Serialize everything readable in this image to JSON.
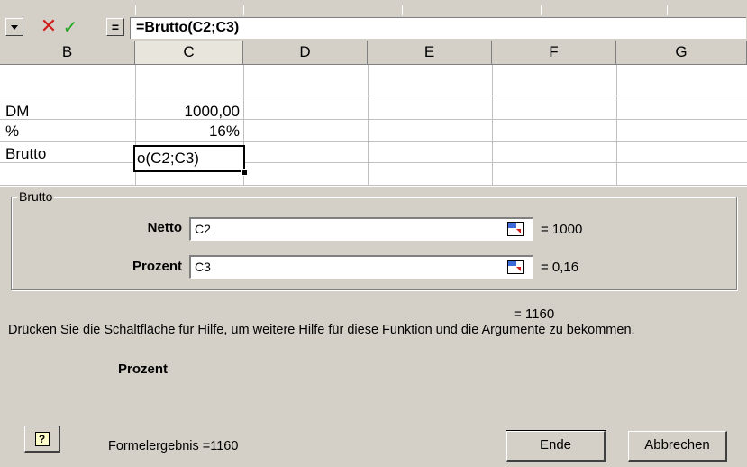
{
  "formula_bar": {
    "formula": "=Brutto(C2;C3)",
    "cancel_icon": "x-icon",
    "enter_icon": "check-icon",
    "function_button": "="
  },
  "columns": [
    "B",
    "C",
    "D",
    "E",
    "F",
    "G"
  ],
  "cells": {
    "b2": "DM",
    "c2": "1000,00",
    "b3": "%",
    "c3": "16%",
    "b4": "Brutto",
    "c4_edit": "o(C2;C3)"
  },
  "dialog": {
    "function_name": "Brutto",
    "args": [
      {
        "label": "Netto",
        "value": "C2",
        "result": "= 1000"
      },
      {
        "label": "Prozent",
        "value": "C3",
        "result": "= 0,16"
      }
    ],
    "function_result": "= 1160",
    "description": "Drücken Sie die Schaltfläche für Hilfe, um weitere Hilfe für diese Funktion und die Argumente zu bekommen.",
    "current_arg": "Prozent",
    "formula_result_text": "Formelergebnis =1160",
    "ok_label": "Ende",
    "cancel_label": "Abbrechen"
  }
}
